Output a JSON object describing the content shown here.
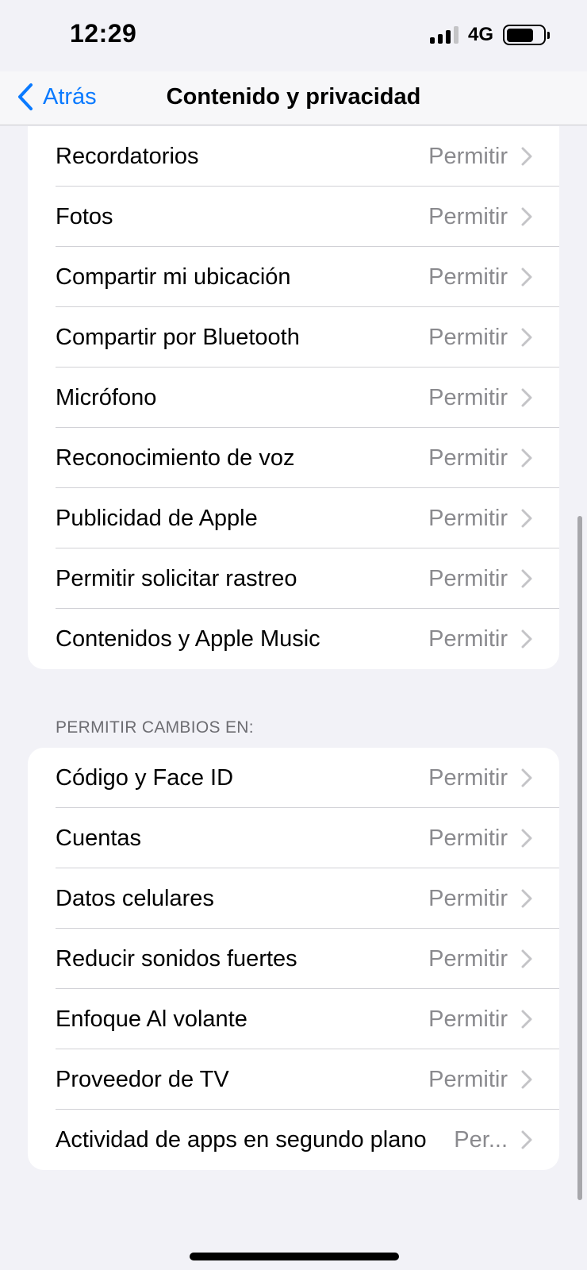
{
  "status_bar": {
    "time": "12:29",
    "network": "4G",
    "signal_bars": 3,
    "battery_level": 0.75
  },
  "nav": {
    "back_label": "Atrás",
    "title": "Contenido y privacidad"
  },
  "colors": {
    "accent": "#0a7aff",
    "background": "#f2f2f7",
    "secondary_text": "#8a8a8e"
  },
  "privacy_section": {
    "items": [
      {
        "label": "Recordatorios",
        "value": "Permitir"
      },
      {
        "label": "Fotos",
        "value": "Permitir"
      },
      {
        "label": "Compartir mi ubicación",
        "value": "Permitir"
      },
      {
        "label": "Compartir por Bluetooth",
        "value": "Permitir"
      },
      {
        "label": "Micrófono",
        "value": "Permitir"
      },
      {
        "label": "Reconocimiento de voz",
        "value": "Permitir"
      },
      {
        "label": "Publicidad de Apple",
        "value": "Permitir"
      },
      {
        "label": "Permitir solicitar rastreo",
        "value": "Permitir"
      },
      {
        "label": "Contenidos y Apple Music",
        "value": "Permitir"
      }
    ]
  },
  "changes_section": {
    "header": "PERMITIR CAMBIOS EN:",
    "items": [
      {
        "label": "Código y Face ID",
        "value": "Permitir"
      },
      {
        "label": "Cuentas",
        "value": "Permitir"
      },
      {
        "label": "Datos celulares",
        "value": "Permitir"
      },
      {
        "label": "Reducir sonidos fuertes",
        "value": "Permitir"
      },
      {
        "label": "Enfoque Al volante",
        "value": "Permitir"
      },
      {
        "label": "Proveedor de TV",
        "value": "Permitir"
      },
      {
        "label": "Actividad de apps en segundo plano",
        "value": "Per..."
      }
    ]
  },
  "icons": {
    "back": "chevron-left-icon",
    "row": "chevron-right-icon",
    "signal": "cellular-signal-icon",
    "battery": "battery-icon"
  }
}
